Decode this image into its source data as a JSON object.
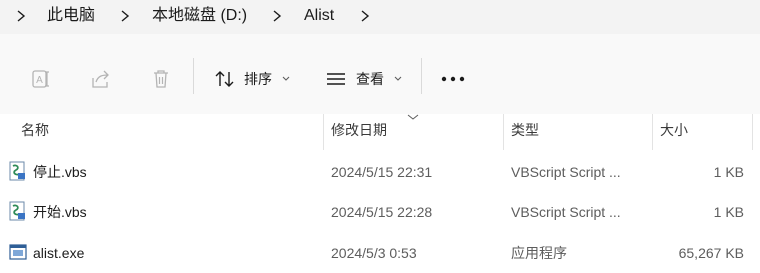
{
  "breadcrumb": {
    "items": [
      "此电脑",
      "本地磁盘 (D:)",
      "Alist"
    ]
  },
  "toolbar": {
    "sort_label": "排序",
    "view_label": "查看",
    "icons": [
      "rename-icon",
      "share-icon",
      "delete-icon",
      "sort-icon",
      "view-icon",
      "more-icon"
    ]
  },
  "columns": {
    "name": "名称",
    "date": "修改日期",
    "type": "类型",
    "size": "大小"
  },
  "files": [
    {
      "name": "停止.vbs",
      "date": "2024/5/15 22:31",
      "type": "VBScript Script ...",
      "size": "1 KB",
      "icon": "vbs-file-icon"
    },
    {
      "name": "开始.vbs",
      "date": "2024/5/15 22:28",
      "type": "VBScript Script ...",
      "size": "1 KB",
      "icon": "vbs-file-icon"
    },
    {
      "name": "alist.exe",
      "date": "2024/5/3 0:53",
      "type": "应用程序",
      "size": "65,267 KB",
      "icon": "exe-file-icon"
    }
  ],
  "colors": {
    "accent": "#0067c0",
    "toolbar_bg": "#f9f9f9",
    "crumb_bg": "#f3f3f3"
  }
}
